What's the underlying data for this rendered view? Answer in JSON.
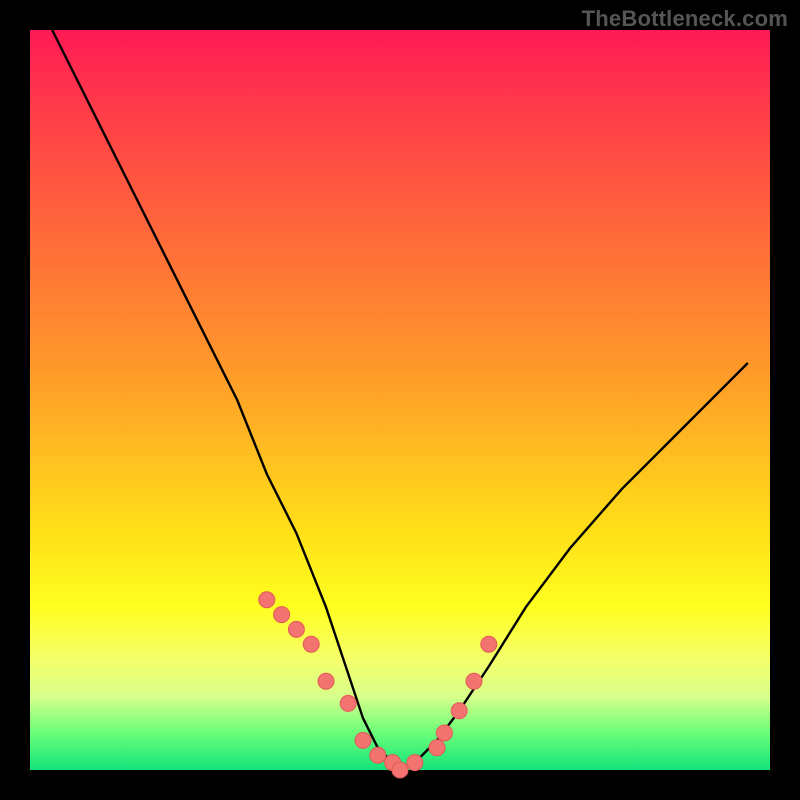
{
  "watermark": "TheBottleneck.com",
  "colors": {
    "curve": "#000000",
    "marker_fill": "#f27370",
    "marker_stroke": "#e25a57",
    "background": "#000000"
  },
  "chart_data": {
    "type": "line",
    "title": "",
    "xlabel": "",
    "ylabel": "",
    "xlim": [
      0,
      100
    ],
    "ylim": [
      0,
      100
    ],
    "grid": false,
    "legend": false,
    "series": [
      {
        "name": "bottleneck-curve",
        "x": [
          3,
          8,
          13,
          18,
          23,
          28,
          32,
          36,
          40,
          43,
          45,
          47,
          49,
          50,
          52,
          55,
          58,
          62,
          67,
          73,
          80,
          88,
          97
        ],
        "values": [
          100,
          90,
          80,
          70,
          60,
          50,
          40,
          32,
          22,
          13,
          7,
          3,
          1,
          0,
          1,
          4,
          8,
          14,
          22,
          30,
          38,
          46,
          55
        ]
      }
    ],
    "markers": {
      "name": "highlighted-points",
      "x": [
        32,
        34,
        36,
        38,
        40,
        43,
        45,
        47,
        49,
        50,
        52,
        55,
        56,
        58,
        60,
        62
      ],
      "values": [
        23,
        21,
        19,
        17,
        12,
        9,
        4,
        2,
        1,
        0,
        1,
        3,
        5,
        8,
        12,
        17
      ]
    }
  }
}
